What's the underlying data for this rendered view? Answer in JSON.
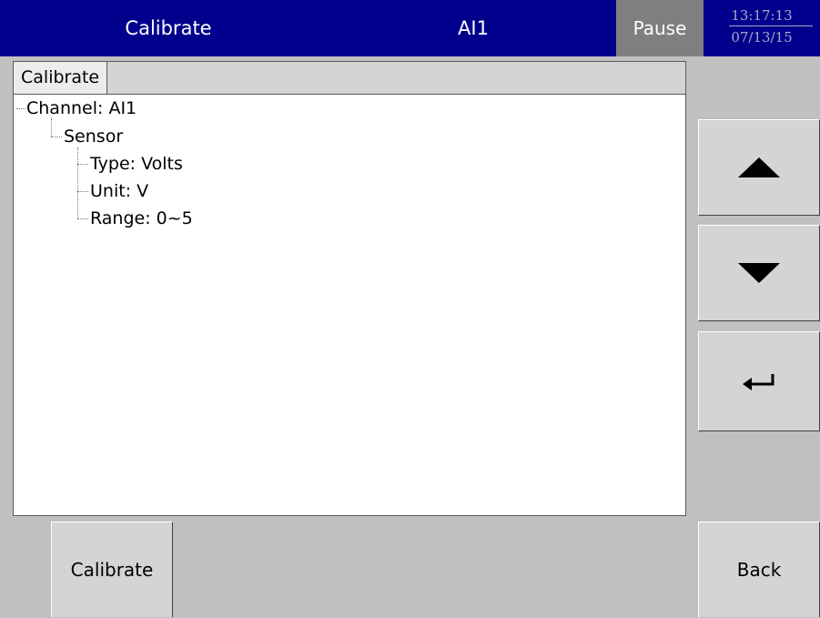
{
  "header": {
    "title": "Calibrate",
    "channel": "AI1",
    "status": "Pause",
    "time": "13:17:13",
    "date": "07/13/15",
    "bar_color": "#00008c",
    "status_color": "#7f7f7f"
  },
  "panel": {
    "tab_label": "Calibrate",
    "tree": {
      "channel": "Channel: AI1",
      "sensor": "Sensor",
      "type": "Type: Volts",
      "unit": "Unit: V",
      "range": "Range: 0~5"
    }
  },
  "side_buttons": {
    "up_icon": "triangle-up-icon",
    "down_icon": "triangle-down-icon",
    "enter_icon": "enter-arrow-icon"
  },
  "bottom_buttons": {
    "calibrate_label": "Calibrate",
    "back_label": "Back"
  }
}
